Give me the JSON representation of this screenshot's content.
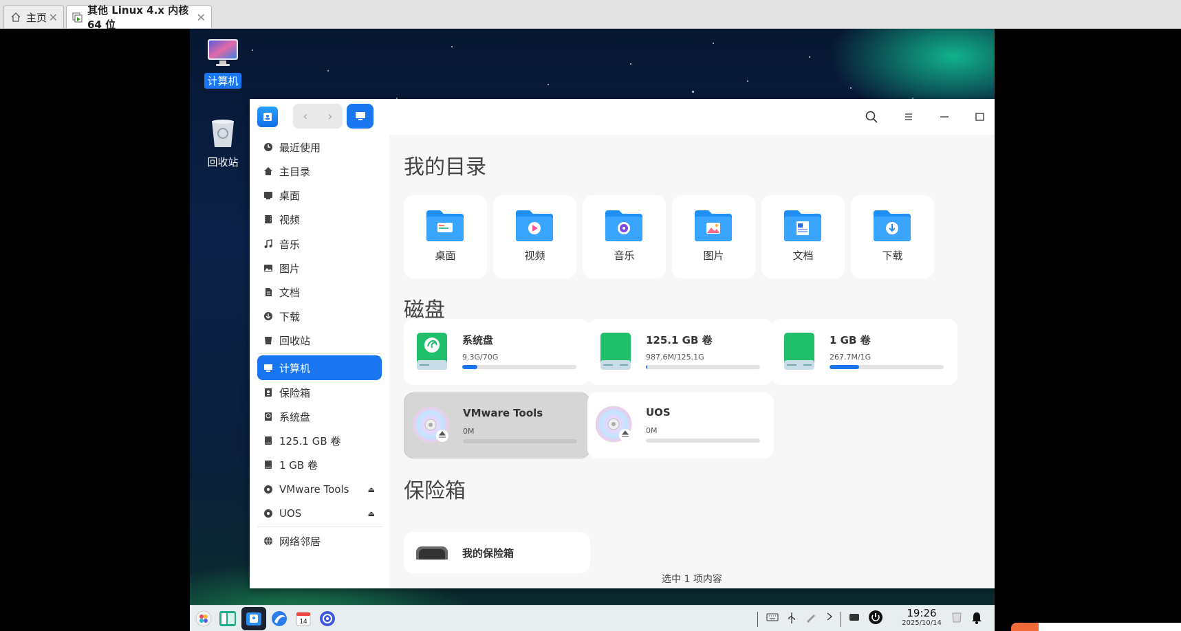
{
  "vm_tabs": [
    {
      "label": "主页",
      "icon": "home-icon"
    },
    {
      "label": "其他 Linux 4.x 内核 64 位",
      "icon": "vm-icon"
    }
  ],
  "desktop_icons": [
    {
      "label": "计算机",
      "icon": "computer-icon",
      "selected": true
    },
    {
      "label": "回收站",
      "icon": "trash-icon",
      "selected": false
    }
  ],
  "sidebar": {
    "items": [
      {
        "label": "最近使用",
        "icon": "clock-icon"
      },
      {
        "label": "主目录",
        "icon": "home-icon"
      },
      {
        "label": "桌面",
        "icon": "desktop-icon"
      },
      {
        "label": "视频",
        "icon": "video-icon"
      },
      {
        "label": "音乐",
        "icon": "music-icon"
      },
      {
        "label": "图片",
        "icon": "image-icon"
      },
      {
        "label": "文档",
        "icon": "document-icon"
      },
      {
        "label": "下载",
        "icon": "download-icon"
      },
      {
        "label": "回收站",
        "icon": "trash-icon"
      },
      {
        "label": "计算机",
        "icon": "computer-icon",
        "active": true
      },
      {
        "label": "保险箱",
        "icon": "vault-icon"
      },
      {
        "label": "系统盘",
        "icon": "system-disk-icon"
      },
      {
        "label": "125.1 GB 卷",
        "icon": "disk-icon"
      },
      {
        "label": "1 GB 卷",
        "icon": "disk-icon"
      },
      {
        "label": "VMware Tools",
        "icon": "optical-disc-icon",
        "eject": true
      },
      {
        "label": "UOS",
        "icon": "optical-disc-icon",
        "eject": true
      },
      {
        "label": "网络邻居",
        "icon": "network-icon"
      }
    ],
    "eject_glyph": "⏏"
  },
  "main": {
    "my_dirs_title": "我的目录",
    "dirs": [
      {
        "label": "桌面",
        "icon": "desktop-folder-icon"
      },
      {
        "label": "视频",
        "icon": "video-folder-icon"
      },
      {
        "label": "音乐",
        "icon": "music-folder-icon"
      },
      {
        "label": "图片",
        "icon": "pictures-folder-icon"
      },
      {
        "label": "文档",
        "icon": "documents-folder-icon"
      },
      {
        "label": "下载",
        "icon": "downloads-folder-icon"
      }
    ],
    "disks_title": "磁盘",
    "disks": [
      {
        "name": "系统盘",
        "size": "9.3G/70G",
        "usage": 0.13,
        "icon": "system-disk-icon"
      },
      {
        "name": "125.1 GB 卷",
        "size": "987.6M/125.1G",
        "usage": 0.01,
        "icon": "disk-icon"
      },
      {
        "name": "1 GB 卷",
        "size": "267.7M/1G",
        "usage": 0.26,
        "icon": "disk-icon"
      },
      {
        "name": "VMware Tools",
        "size": "0M",
        "usage": 0,
        "icon": "optical-disc-icon",
        "selected": true
      },
      {
        "name": "UOS",
        "size": "0M",
        "usage": 0,
        "icon": "optical-disc-icon"
      }
    ],
    "vault_title": "保险箱",
    "vault": {
      "name": "我的保险箱",
      "icon": "vault-icon"
    }
  },
  "status": "选中 1 项内容",
  "taskbar": {
    "apps": [
      "launcher-icon",
      "multitasking-icon",
      "file-manager-icon",
      "browser-icon",
      "calendar-icon",
      "settings-icon"
    ],
    "calendar_day": "14",
    "time": "19:26",
    "date": "2025/10/14"
  },
  "colors": {
    "accent": "#1a76f0",
    "disk_green": "#1fbf6b"
  }
}
